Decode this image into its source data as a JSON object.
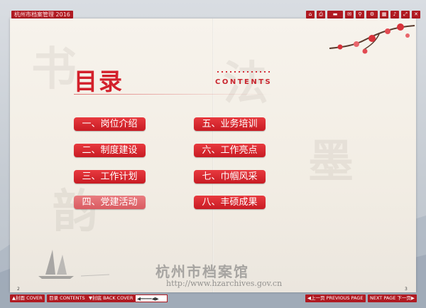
{
  "window": {
    "title": "杭州市档案管理 2016"
  },
  "toolbar": {
    "icons": [
      "home-icon",
      "print-icon",
      "zoom-slider",
      "share-icon",
      "search-icon",
      "settings-icon",
      "thumbnail-icon",
      "sound-icon",
      "fullscreen-icon",
      "close-icon"
    ]
  },
  "page": {
    "title": "目录",
    "subtitle": "CONTENTS",
    "items_left": [
      "一、岗位介绍",
      "二、制度建设",
      "三、工作计划",
      "四、党建活动"
    ],
    "items_right": [
      "五、业务培训",
      "六、工作亮点",
      "七、巾帼风采",
      "八、丰硕成果"
    ],
    "watermark_name": "杭州市档案馆",
    "watermark_url": "http://www.hzarchives.gov.cn",
    "page_left": "2",
    "page_right": "3"
  },
  "bottombar": {
    "front_cover": "▲封面 COVER",
    "contents": "目录 CONTENTS",
    "back_cover": "▼封底 BACK COVER",
    "prev_page": "◀上一页 PREVIOUS PAGE",
    "next_page": "NEXT PAGE 下一页▶"
  },
  "colors": {
    "accent": "#d3202b",
    "bar": "#b01a22"
  }
}
